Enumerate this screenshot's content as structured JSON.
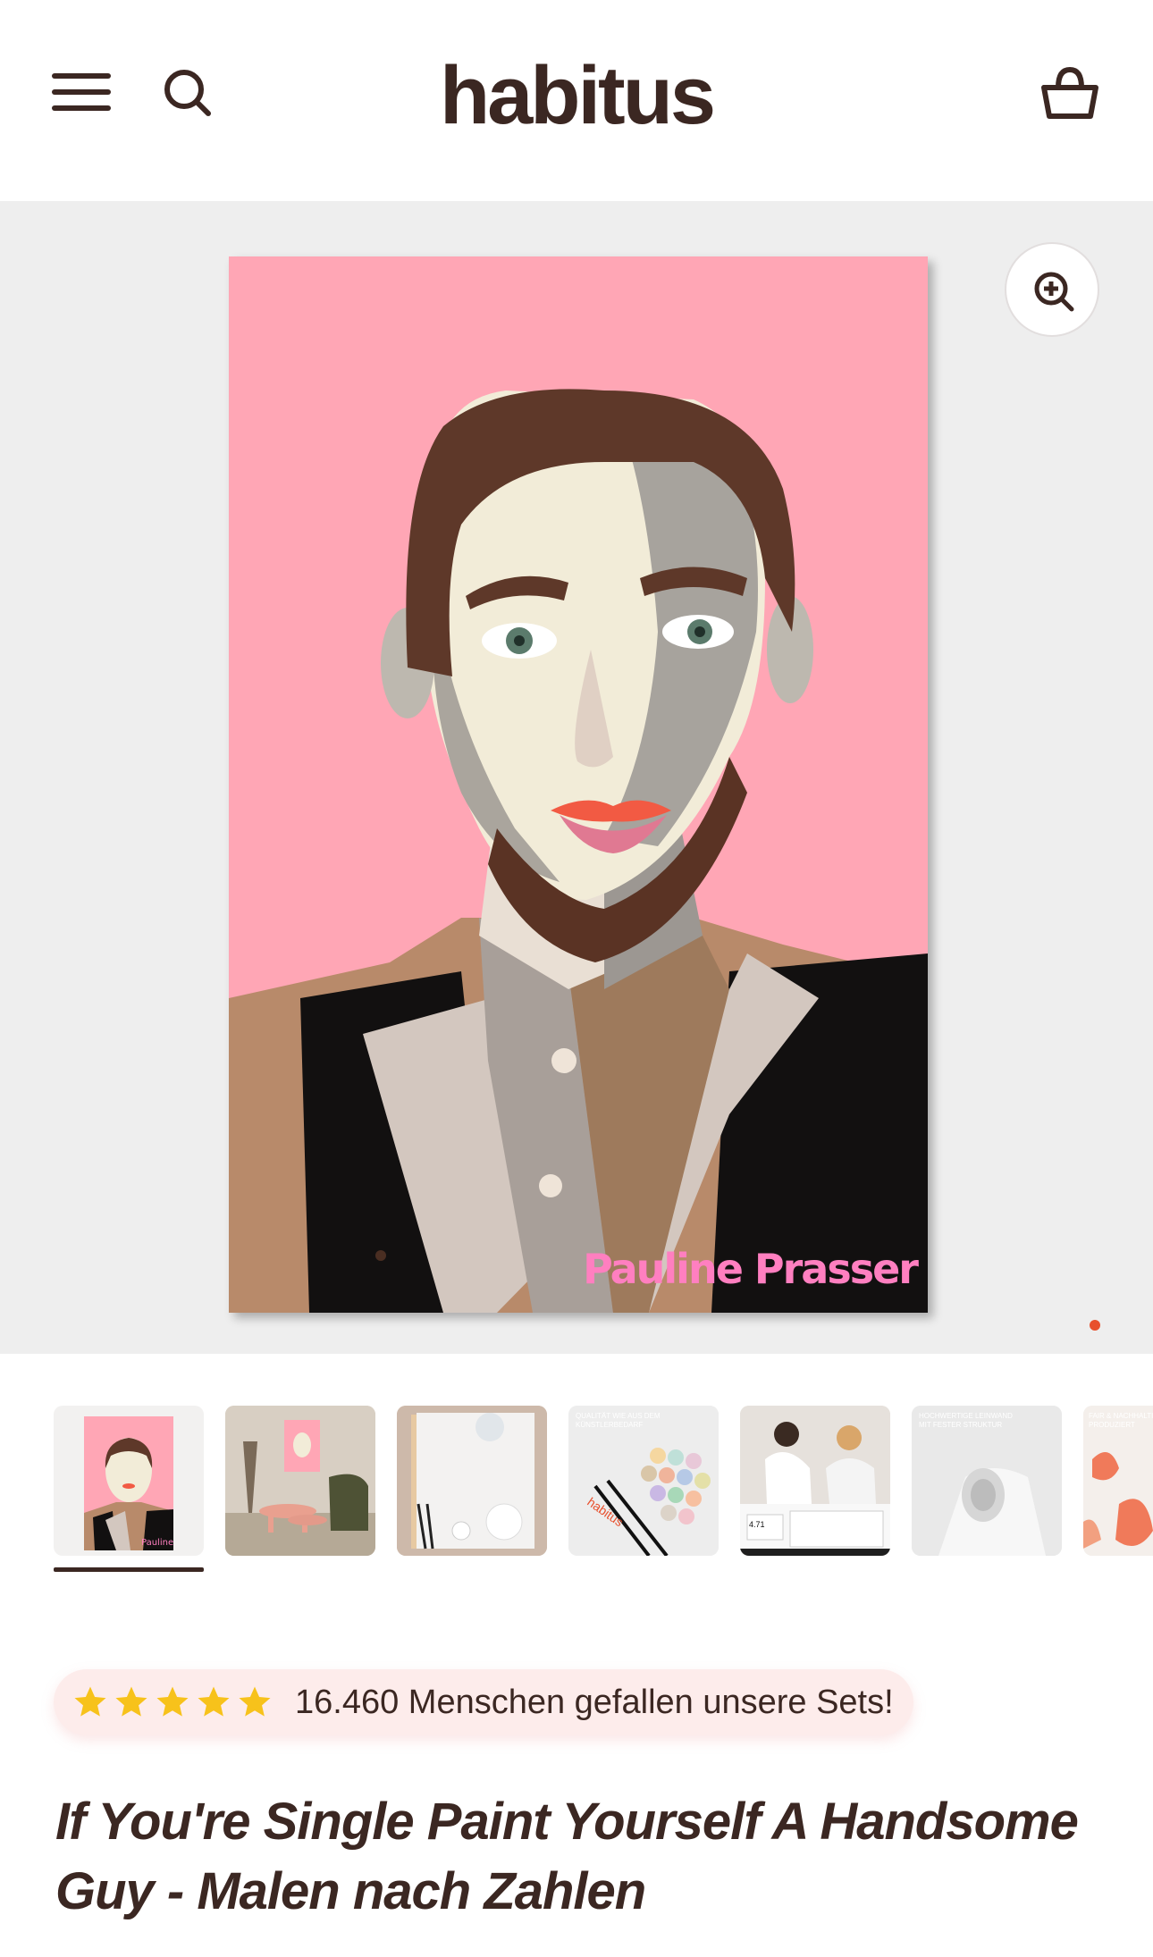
{
  "header": {
    "logo": "habitus",
    "menu_icon": "hamburger-menu-icon",
    "search_icon": "search-icon",
    "cart_icon": "basket-icon"
  },
  "gallery": {
    "artist_signature": "Pauline Prasser",
    "zoom_icon": "zoom-in-icon",
    "active_slide": 1
  },
  "thumbnails": [
    {
      "name": "thumb-portrait",
      "active": true
    },
    {
      "name": "thumb-living-room"
    },
    {
      "name": "thumb-kit-contents"
    },
    {
      "name": "thumb-paints-brushes",
      "caption": "QUALITÄT WIE AUS DEM KÜNSTLERBEDARF"
    },
    {
      "name": "thumb-people-painting",
      "badge": "4.71"
    },
    {
      "name": "thumb-canvas-roll",
      "caption": "HOCHWERTIGE LEINWAND MIT FESTER STRUKTUR"
    },
    {
      "name": "thumb-fair-produced",
      "caption": "FAIR & NACHHALTIG PRODUZIERT"
    }
  ],
  "rating": {
    "stars": 5,
    "text": "16.460 Menschen gefallen unsere Sets!"
  },
  "product": {
    "title": "If You're Single Paint Yourself A Handsome Guy - Malen nach Zahlen"
  },
  "colors": {
    "brand_text": "#3b2722",
    "accent": "#e8502d",
    "star": "#f7c21b",
    "pill_bg": "#fdeceb",
    "gallery_bg": "#eeeeee",
    "art_bg": "#ffa6b5"
  }
}
